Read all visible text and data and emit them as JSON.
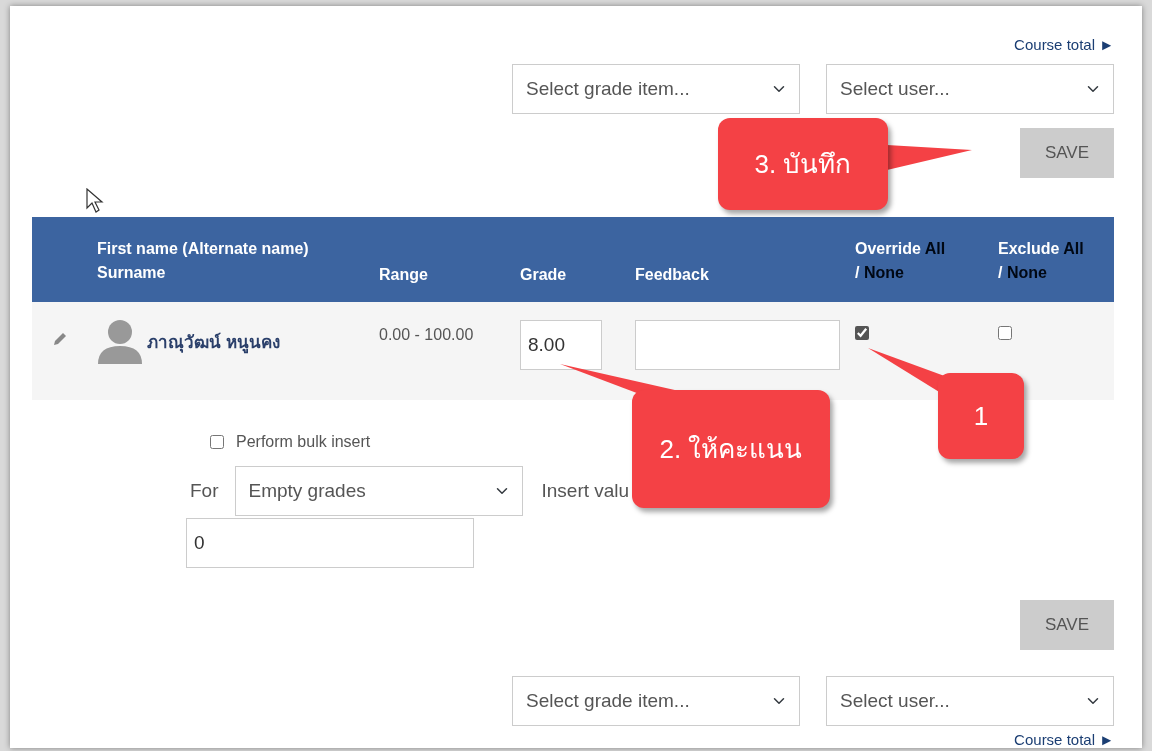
{
  "course_total_top": "Course total ►",
  "selects_top": [
    {
      "value": "Select grade item..."
    },
    {
      "value": "Select user..."
    }
  ],
  "save_top": "SAVE",
  "table": {
    "columns": [
      {
        "kind": "name",
        "label": "First name (Alternate name)",
        "sub": "Surname"
      },
      {
        "kind": "plain",
        "label": "Range"
      },
      {
        "kind": "plain",
        "label": "Grade"
      },
      {
        "kind": "plain",
        "label": "Feedback"
      },
      {
        "kind": "toggle",
        "label": "Override",
        "all": "All",
        "sep": "/",
        "none": "None"
      },
      {
        "kind": "toggle",
        "label": "Exclude",
        "all": "All",
        "sep": "/",
        "none": "None"
      }
    ],
    "rows": [
      {
        "name": "ภาณุวัฒน์ หนูนคง",
        "range": "0.00 - 100.00",
        "grade": "8.00",
        "override": true,
        "exclude": false
      }
    ]
  },
  "bulk": {
    "label": "Perform bulk insert",
    "checked": false,
    "for_label": "For",
    "for_value": "Empty grades",
    "insert_label": "Insert valu",
    "value": "0"
  },
  "save_bottom": "SAVE",
  "selects_bottom": [
    {
      "value": "Select grade item..."
    },
    {
      "value": "Select user..."
    }
  ],
  "course_total_bottom": "Course total ►",
  "callouts": [
    {
      "text": "3. บันทึก"
    },
    {
      "text": "2. ให้คะแนน"
    },
    {
      "text": "1"
    }
  ]
}
